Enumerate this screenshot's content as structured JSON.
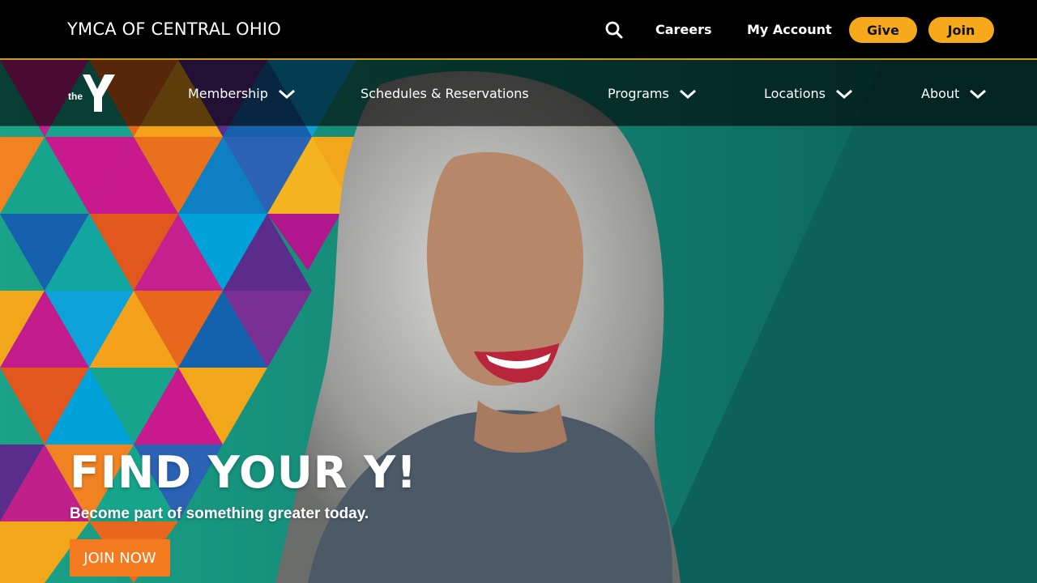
{
  "header": {
    "brand": "YMCA OF CENTRAL OHIO",
    "search_icon": "search-icon",
    "links": {
      "careers": "Careers",
      "my_account": "My Account"
    },
    "buttons": {
      "give": "Give",
      "join": "Join"
    }
  },
  "nav": {
    "logo_alt": "the Y",
    "items": [
      {
        "label": "Membership",
        "dropdown": true
      },
      {
        "label": "Schedules & Reservations",
        "dropdown": false
      },
      {
        "label": "Programs",
        "dropdown": true
      },
      {
        "label": "Locations",
        "dropdown": true
      },
      {
        "label": "About",
        "dropdown": true
      }
    ]
  },
  "hero": {
    "title": "FIND YOUR Y!",
    "subtitle": "Become part of something greater today.",
    "cta": "JOIN NOW"
  },
  "colors": {
    "accent": "#f7a91c",
    "cta": "#f47b20",
    "teal": "#137d73",
    "topbar": "#000000"
  }
}
